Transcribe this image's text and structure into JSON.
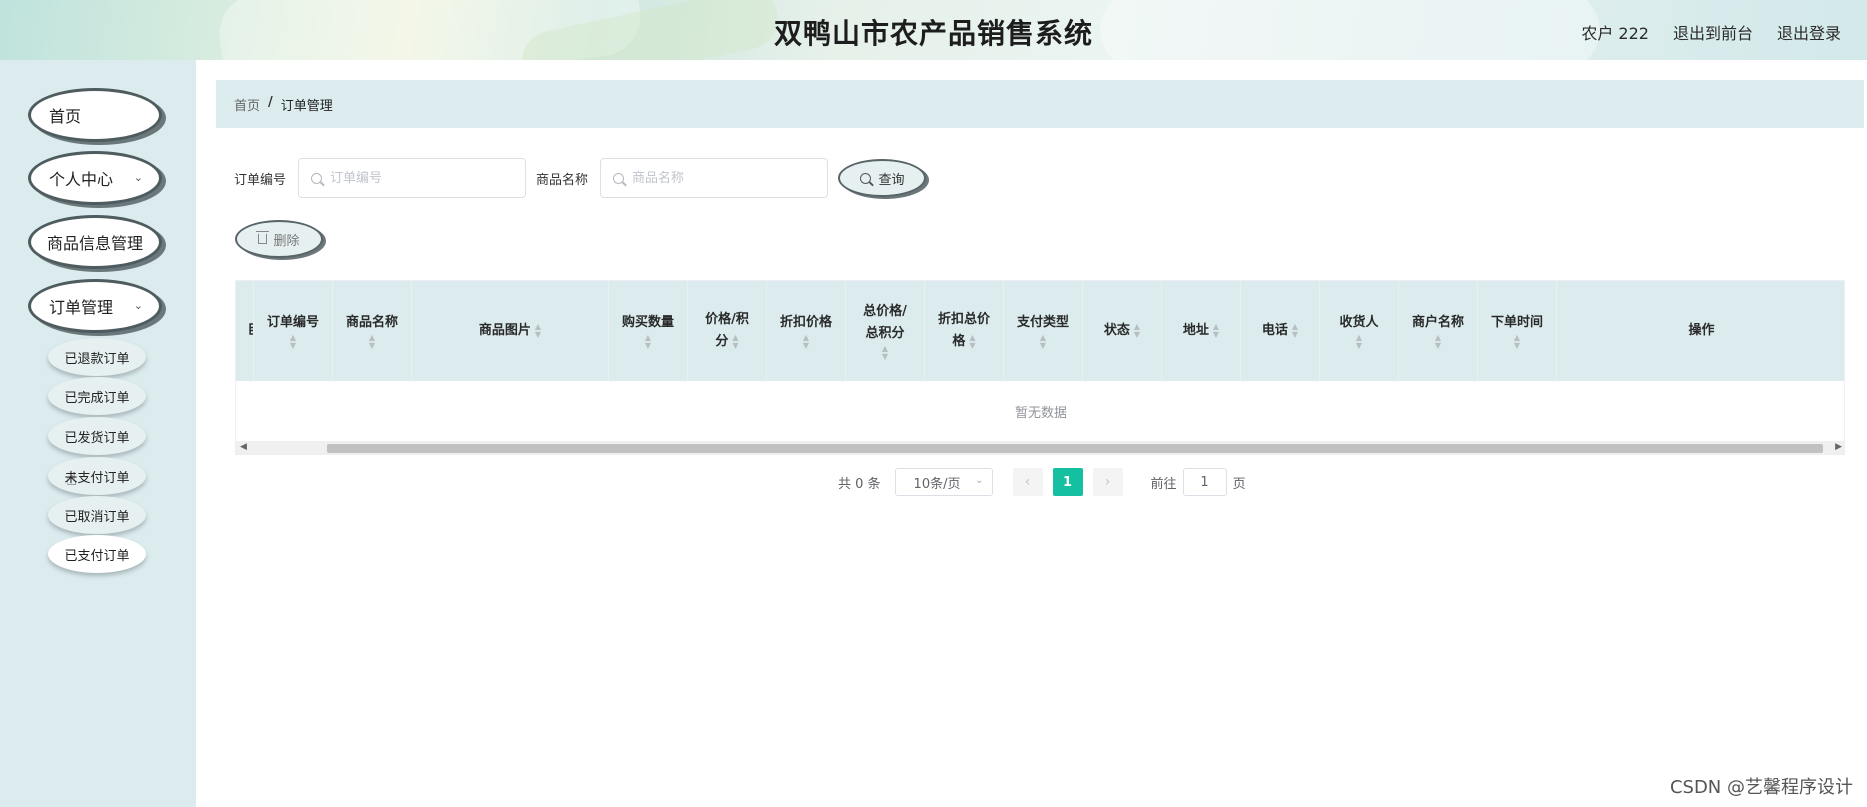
{
  "header": {
    "title": "双鸭山市农产品销售系统",
    "user": "农户 222",
    "to_front": "退出到前台",
    "logout": "退出登录"
  },
  "sidebar": {
    "items": [
      {
        "label": "首页"
      },
      {
        "label": "个人中心"
      },
      {
        "label": "商品信息管理"
      },
      {
        "label": "订单管理"
      }
    ],
    "sub_items": [
      {
        "label": "已退款订单"
      },
      {
        "label": "已完成订单"
      },
      {
        "label": "已发货订单"
      },
      {
        "label": "未支付订单"
      },
      {
        "label": "已取消订单"
      },
      {
        "label": "已支付订单"
      }
    ]
  },
  "breadcrumb": {
    "home": "首页",
    "separator": "/",
    "current": "订单管理"
  },
  "search": {
    "order_no_label": "订单编号",
    "order_no_placeholder": "订单编号",
    "product_label": "商品名称",
    "product_placeholder": "商品名称",
    "query_button": "查询"
  },
  "toolbar": {
    "delete_button": "删除"
  },
  "table": {
    "columns": {
      "cut": "臣",
      "order_no": "订单编号",
      "product_name": "商品名称",
      "product_image": "商品图片",
      "quantity": "购买数量",
      "price_line1": "价格/积",
      "price_line2": "分",
      "discount_price": "折扣价格",
      "total_line1": "总价格/",
      "total_line2": "总积分",
      "discount_total_line1": "折扣总价",
      "discount_total_line2": "格",
      "pay_type": "支付类型",
      "status": "状态",
      "address": "地址",
      "phone": "电话",
      "receiver": "收货人",
      "merchant": "商户名称",
      "order_time": "下单时间",
      "actions": "操作"
    },
    "empty_text": "暂无数据"
  },
  "pagination": {
    "total": "共 0 条",
    "page_size": "10条/页",
    "current_page": "1",
    "goto_label": "前往",
    "goto_value": "1",
    "page_unit": "页"
  },
  "watermark": "CSDN @艺馨程序设计"
}
